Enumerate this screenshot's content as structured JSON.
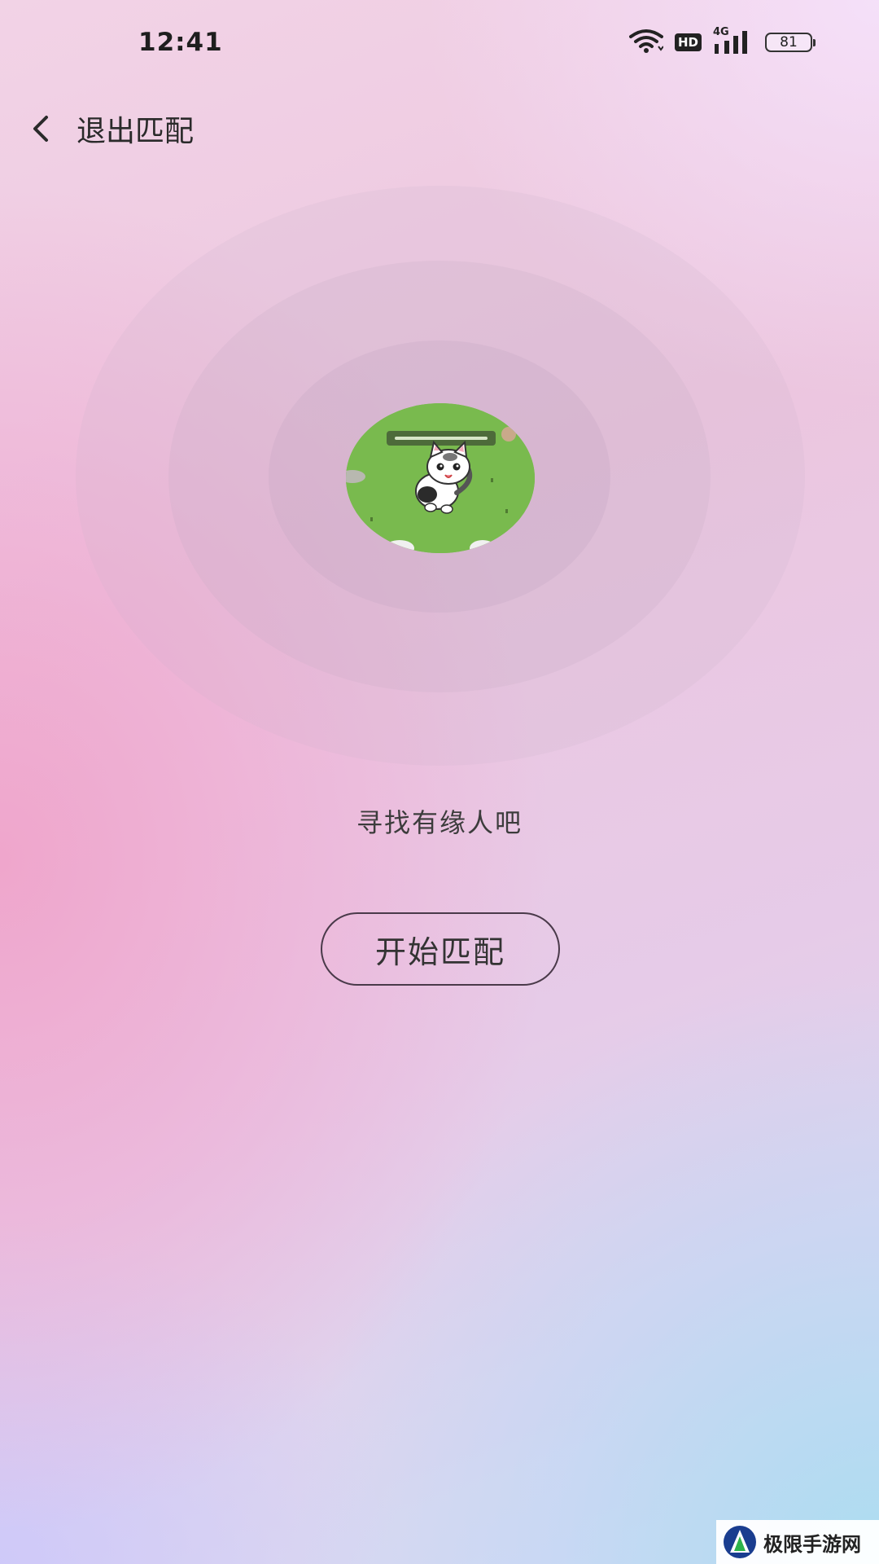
{
  "status_bar": {
    "time": "12:41",
    "network_type": "4G",
    "hd_label": "HD",
    "battery_level": "81"
  },
  "header": {
    "title": "退出匹配",
    "back_icon": "chevron-left-icon"
  },
  "radar": {
    "avatar_icon": "cat-avatar-image"
  },
  "main": {
    "prompt": "寻找有缘人吧",
    "start_button_label": "开始匹配"
  },
  "watermark": {
    "text": "极限手游网"
  },
  "colors": {
    "avatar_green": "#79ba4e",
    "button_border": "#4a3a4a",
    "text_dark": "#333333"
  }
}
